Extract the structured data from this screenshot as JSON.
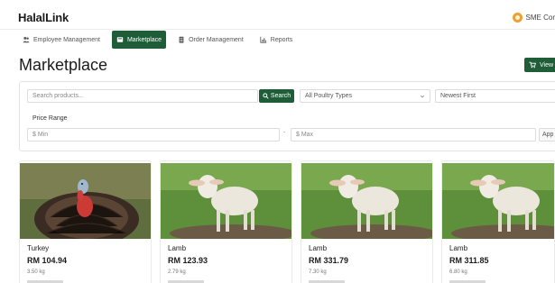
{
  "header": {
    "brand": "HalalLink",
    "user_label": "SME Cor"
  },
  "nav": [
    {
      "label": "Employee Management",
      "icon": "users-icon"
    },
    {
      "label": "Marketplace",
      "icon": "store-icon",
      "active": true
    },
    {
      "label": "Order Management",
      "icon": "clipboard-icon"
    },
    {
      "label": "Reports",
      "icon": "chart-icon"
    }
  ],
  "page": {
    "title": "Marketplace",
    "view_button": "View"
  },
  "filters": {
    "search_placeholder": "Search products...",
    "search_button": "Search",
    "type_select": "All Poultry Types",
    "sort_select": "Newest First",
    "price_label": "Price Range",
    "min_placeholder": "$ Min",
    "dash": "-",
    "max_placeholder": "$ Max",
    "apply_button": "App"
  },
  "products": [
    {
      "name": "Turkey",
      "price": "RM 104.94",
      "weight": "3.50 kg",
      "image": "turkey"
    },
    {
      "name": "Lamb",
      "price": "RM 123.93",
      "weight": "2.79 kg",
      "image": "lamb"
    },
    {
      "name": "Lamb",
      "price": "RM 331.79",
      "weight": "7.30 kg",
      "image": "lamb"
    },
    {
      "name": "Lamb",
      "price": "RM 311.85",
      "weight": "6.80 kg",
      "image": "lamb"
    }
  ],
  "colors": {
    "primary": "#1f5c38",
    "avatar": "#f0a030"
  }
}
